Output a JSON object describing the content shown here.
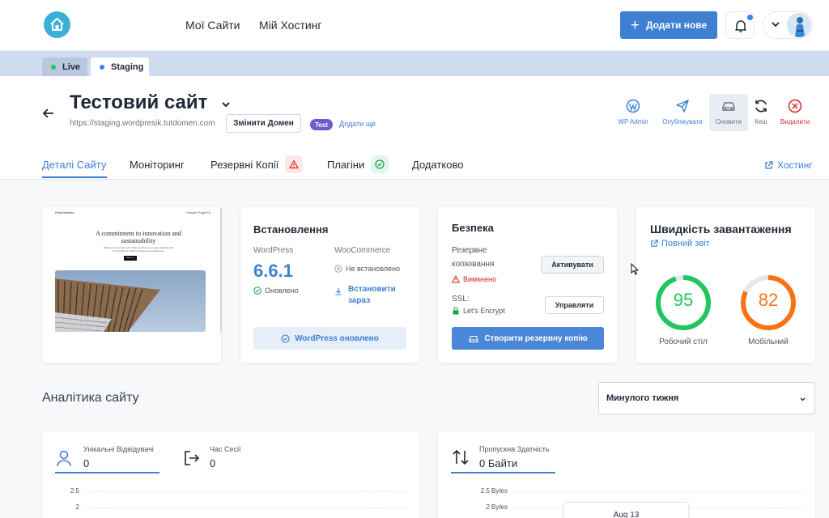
{
  "nav": {
    "links": [
      "Мої Сайти",
      "Мій Хостинг"
    ],
    "add_button": "Додати нове"
  },
  "env_tabs": [
    {
      "label": "Live",
      "color": "#22c55e"
    },
    {
      "label": "Staging",
      "color": "#3b82f6"
    }
  ],
  "site": {
    "title": "Тестовий сайт",
    "url": "https://staging.wordpresik.tutdomen.com",
    "change_domain": "Змінити Домен",
    "badge": "Test",
    "add_more": "Додати ще"
  },
  "actions": [
    {
      "label": "WP Admin",
      "icon": "wordpress-icon"
    },
    {
      "label": "Опублікувати",
      "icon": "send-icon"
    },
    {
      "label": "Оновити",
      "icon": "car-icon"
    },
    {
      "label": "Кеш",
      "icon": "refresh-icon"
    },
    {
      "label": "Видалити",
      "icon": "delete-icon"
    }
  ],
  "tabs": [
    {
      "label": "Деталі Сайту"
    },
    {
      "label": "Моніторинг"
    },
    {
      "label": "Резервні Копії",
      "icon": "warning-icon"
    },
    {
      "label": "Плагіни",
      "icon": "check-circle-icon"
    },
    {
      "label": "Додатково"
    }
  ],
  "hosting_link": "Хостинг",
  "preview": {
    "brand": "FirstLimitless",
    "nav": "Sample Page   Ed",
    "headline": "A commitment to innovation and sustainability",
    "text": "Études is a pioneering firm that seamlessly merges creativity and functionality to redefine architectural excellence.",
    "button": "About us"
  },
  "install": {
    "title": "Встановлення",
    "wp_label": "WordPress",
    "wp_version": "6.6.1",
    "wp_status": "Оновлено",
    "wc_label": "WooCommerce",
    "wc_status": "Не встановлено",
    "wc_link": "Встановити зараз",
    "button": "WordPress оновлено"
  },
  "security": {
    "title": "Безпека",
    "backup_label": "Резервне копіювання",
    "backup_status": "Вимкнено",
    "backup_button": "Активувати",
    "ssl_label": "SSL:",
    "ssl_value": "Let's Encrypt",
    "ssl_button": "Управляти",
    "create_backup": "Створити резервну копію"
  },
  "speed": {
    "title": "Швидкість завантаження",
    "report_link": "Повний звіт",
    "desktop": {
      "score": 95,
      "label": "Робочий стіл",
      "color": "#22c55e"
    },
    "mobile": {
      "score": 82,
      "label": "Мобільний",
      "color": "#f97316"
    }
  },
  "analytics": {
    "title": "Аналітика сайту",
    "period": "Минулого тижня",
    "visitors_label": "Унікальні Відвідувачі",
    "visitors_value": "0",
    "session_label": "Час Сесії",
    "session_value": "0",
    "bandwidth_label": "Пропускна Здатність",
    "bandwidth_value": "0 Байти",
    "y_left": [
      "2.5",
      "2"
    ],
    "y_right": [
      "2.5 Bytes",
      "2 Bytes"
    ],
    "tooltip": "Aug 13"
  }
}
